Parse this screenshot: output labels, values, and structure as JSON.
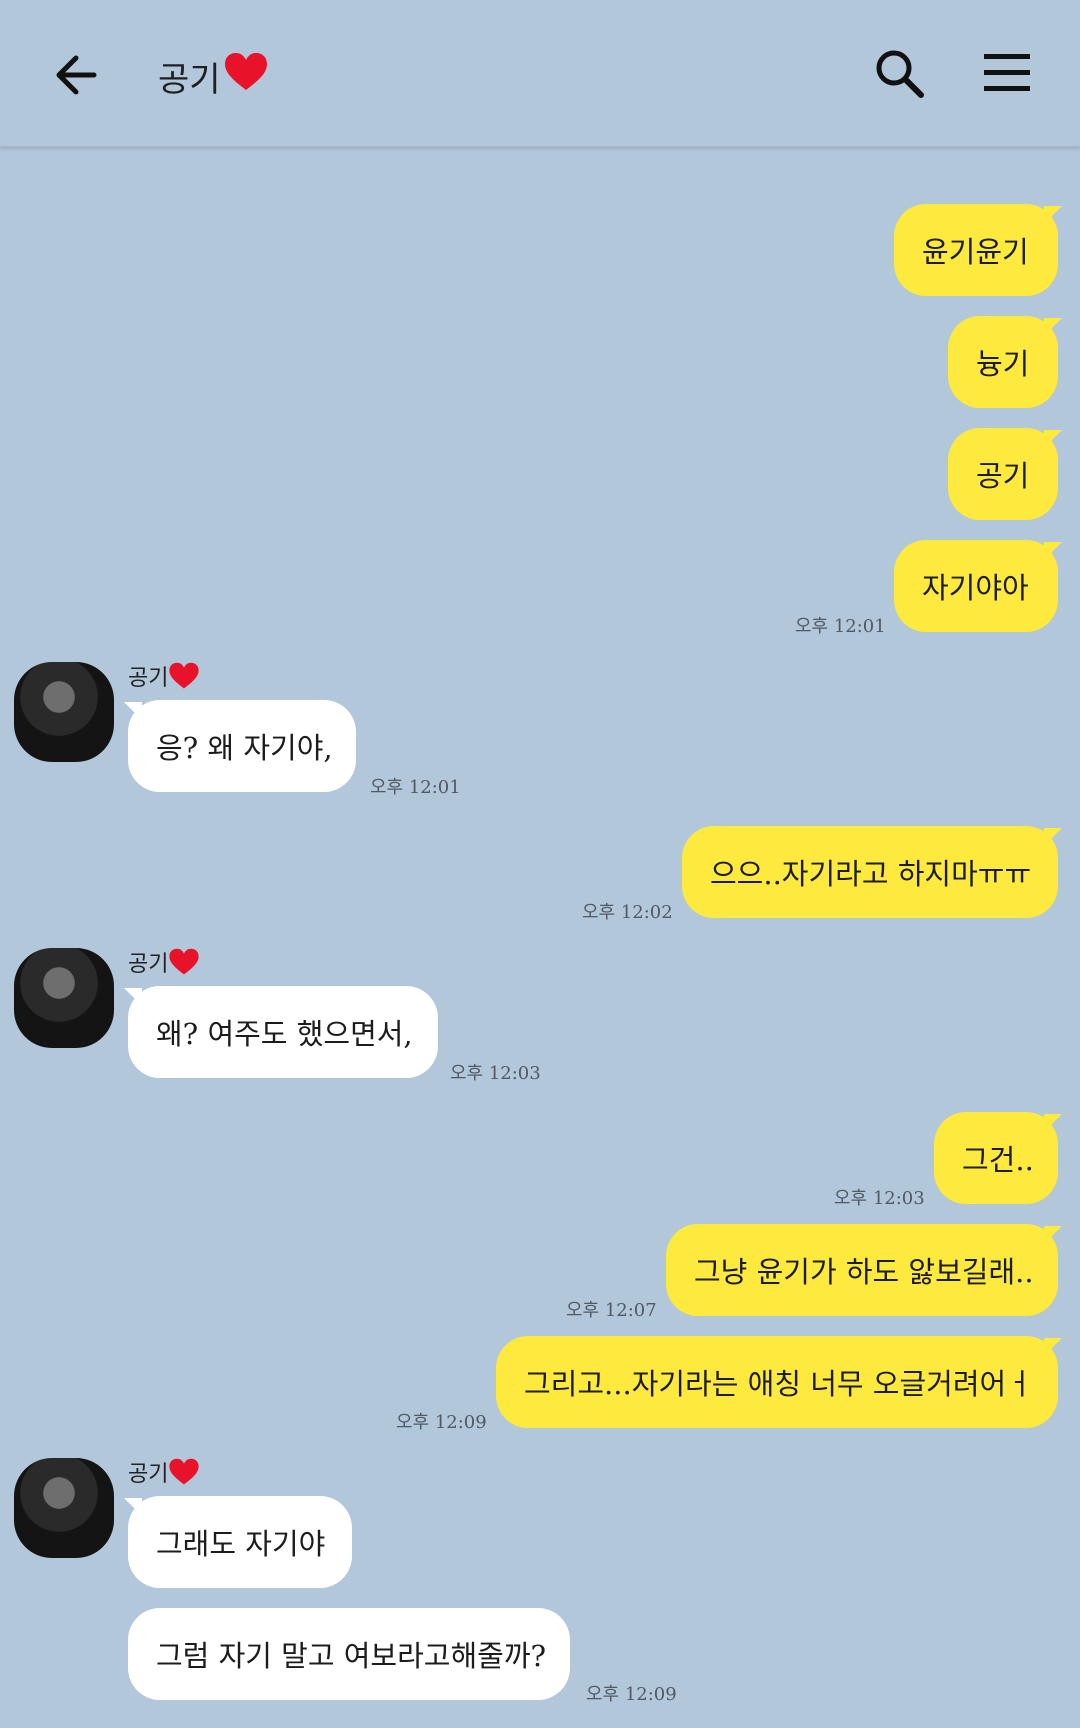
{
  "header": {
    "contact_name": "공기"
  },
  "messages": [
    {
      "side": "me",
      "text": "윤기윤기"
    },
    {
      "side": "me",
      "text": "늉기"
    },
    {
      "side": "me",
      "text": "공기"
    },
    {
      "side": "me",
      "text": "자기야아",
      "time": "오후 12:01"
    },
    {
      "side": "them",
      "sender": "공기",
      "text": "응? 왜 자기야,",
      "time": "오후 12:01"
    },
    {
      "side": "me",
      "text": "으으..자기라고 하지마ㅠㅠ",
      "time": "오후 12:02"
    },
    {
      "side": "them",
      "sender": "공기",
      "text": "왜? 여주도 했으면서,",
      "time": "오후 12:03"
    },
    {
      "side": "me",
      "text": "그건..",
      "time": "오후 12:03"
    },
    {
      "side": "me",
      "text": "그냥 윤기가 하도 앓보길래..",
      "time": "오후 12:07"
    },
    {
      "side": "me",
      "text": "그리고...자기라는 애칭 너무 오글거려어ㅓ",
      "time": "오후 12:09"
    },
    {
      "side": "them",
      "sender": "공기",
      "text": "그래도 자기야"
    },
    {
      "side": "them",
      "text": "그럼 자기 말고 여보라고해줄까?",
      "time": "오후 12:09"
    }
  ]
}
